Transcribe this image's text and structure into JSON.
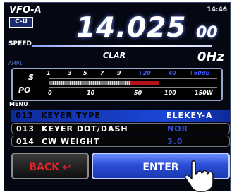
{
  "header": {
    "vfo": "VFO-A",
    "mode": "C-U",
    "clock": "14:46",
    "speed": "SPEED",
    "amp": "AMP1"
  },
  "frequency": {
    "main": "14.025",
    "small": "00"
  },
  "clar": {
    "label": "CLAR",
    "value": "0Hz"
  },
  "meter": {
    "s_label": "S",
    "po_label": "PO",
    "s_scale": [
      "1",
      "3",
      "5",
      "7",
      "9",
      "+20",
      "+40",
      "+60dB"
    ],
    "po_scale": [
      "0",
      "10",
      "50",
      "100",
      "150W"
    ]
  },
  "menu": {
    "label": "MENU",
    "items": [
      {
        "num": "012",
        "name": "KEYER TYPE",
        "value": "ELEKEY-A",
        "selected": true
      },
      {
        "num": "013",
        "name": "KEYER DOT/DASH",
        "value": "NOR",
        "selected": false
      },
      {
        "num": "014",
        "name": "CW WEIGHT",
        "value": "3.0",
        "selected": false
      }
    ]
  },
  "buttons": {
    "back": "BACK",
    "enter": "ENTER"
  },
  "colors": {
    "accent": "#1b46d6",
    "back_text": "#e0222a"
  }
}
